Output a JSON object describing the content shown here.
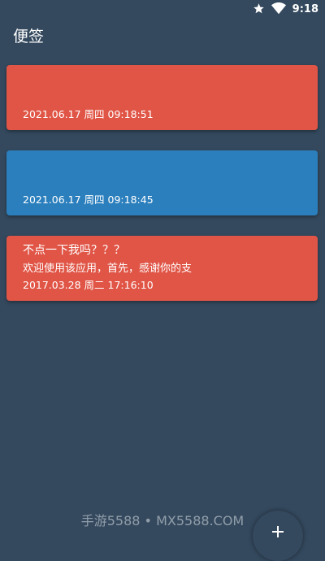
{
  "status_bar": {
    "time": "9:18",
    "icons": [
      "star-icon",
      "wifi-icon"
    ]
  },
  "app_bar": {
    "title": "便签"
  },
  "notes": [
    {
      "title": "",
      "content": "",
      "date": "2021.06.17 周四 09:18:51",
      "color": "#e05546"
    },
    {
      "title": "",
      "content": "",
      "date": "2021.06.17 周四 09:18:45",
      "color": "#2b7fbd"
    },
    {
      "title": "不点一下我吗？？？",
      "content": "欢迎使用该应用，首先，感谢你的支",
      "date": "2017.03.28 周二 17:16:10",
      "color": "#e05546"
    }
  ],
  "watermark": "手游5588 • MX5588.COM",
  "fab": {
    "icon": "plus-icon"
  },
  "colors": {
    "background": "#34495e",
    "text": "#ffffff"
  }
}
